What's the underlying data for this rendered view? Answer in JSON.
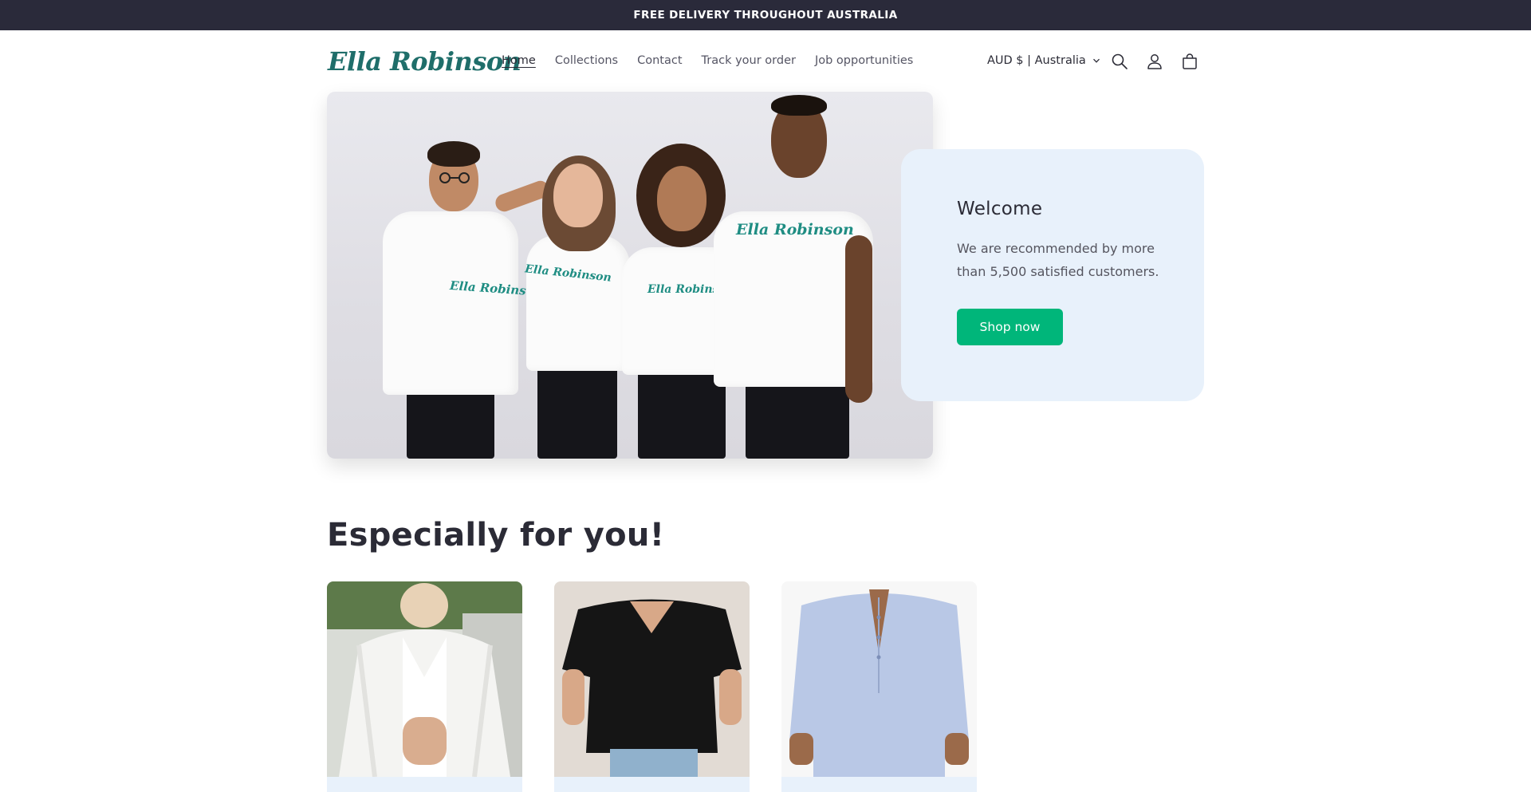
{
  "announcement": {
    "text": "FREE DELIVERY THROUGHOUT AUSTRALIA"
  },
  "header": {
    "logo": "Ella Robinson",
    "nav": [
      {
        "label": "Home",
        "active": true
      },
      {
        "label": "Collections",
        "active": false
      },
      {
        "label": "Contact",
        "active": false
      },
      {
        "label": "Track your order",
        "active": false
      },
      {
        "label": "Job opportunities",
        "active": false
      }
    ],
    "locale": "AUD $ | Australia",
    "icons": [
      "search-icon",
      "account-icon",
      "cart-icon"
    ]
  },
  "hero": {
    "image_alt_brand": "Ella Robinson",
    "welcome": {
      "title": "Welcome",
      "text": "We are recommended by more than 5,500 satisfied customers.",
      "button": "Shop now"
    }
  },
  "featured": {
    "title": "Especially for you!",
    "products": [
      {
        "image": "white-lace-cardigan"
      },
      {
        "image": "black-v-neck-top"
      },
      {
        "image": "blue-linen-shirt"
      }
    ]
  },
  "colors": {
    "announcement_bg": "#2a2a3a",
    "logo": "#1f6e6a",
    "accent_button": "#00b67a",
    "card_bg": "#e8f1fb"
  }
}
